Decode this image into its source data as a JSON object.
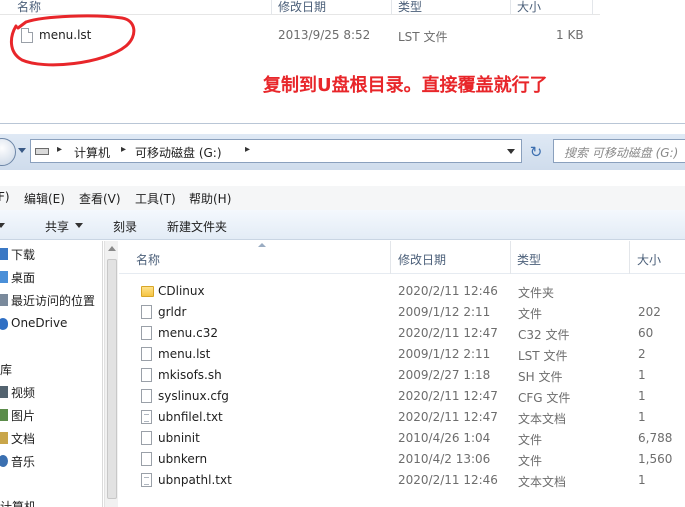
{
  "top": {
    "headers": {
      "name": "名称",
      "date": "修改日期",
      "type": "类型",
      "size": "大小"
    },
    "file": {
      "name": "menu.lst",
      "date": "2013/9/25 8:52",
      "type": "LST 文件",
      "size": "1 KB"
    },
    "note": "复制到U盘根目录。直接覆盖就行了",
    "note_color": "#e8262a"
  },
  "address": {
    "crumbs": [
      "计算机",
      "可移动磁盘 (G:)"
    ],
    "search_placeholder": "搜索 可移动磁盘 (G:)"
  },
  "menu": [
    "F)",
    "编辑(E)",
    "查看(V)",
    "工具(T)",
    "帮助(H)"
  ],
  "toolbar": {
    "share": "共享",
    "burn": "刻录",
    "new_folder": "新建文件夹"
  },
  "nav": {
    "favorites": [
      "下载",
      "桌面",
      "最近访问的位置"
    ],
    "onedrive": "OneDrive",
    "libraries_header": "库",
    "libraries": [
      "视频",
      "图片",
      "文档",
      "音乐"
    ],
    "computer": "计算机"
  },
  "columns": {
    "name": "名称",
    "date": "修改日期",
    "type": "类型",
    "size": "大小"
  },
  "files": [
    {
      "name": "CDlinux",
      "date": "2020/2/11 12:46",
      "type": "文件夹",
      "size": "",
      "icon": "folder"
    },
    {
      "name": "grldr",
      "date": "2009/1/12 2:11",
      "type": "文件",
      "size": "202",
      "icon": "file"
    },
    {
      "name": "menu.c32",
      "date": "2020/2/11 12:47",
      "type": "C32 文件",
      "size": "60",
      "icon": "file"
    },
    {
      "name": "menu.lst",
      "date": "2009/1/12 2:11",
      "type": "LST 文件",
      "size": "2",
      "icon": "file"
    },
    {
      "name": "mkisofs.sh",
      "date": "2009/2/27 1:18",
      "type": "SH 文件",
      "size": "1",
      "icon": "file"
    },
    {
      "name": "syslinux.cfg",
      "date": "2020/2/11 12:47",
      "type": "CFG 文件",
      "size": "1",
      "icon": "file"
    },
    {
      "name": "ubnfilel.txt",
      "date": "2020/2/11 12:47",
      "type": "文本文档",
      "size": "1",
      "icon": "txt"
    },
    {
      "name": "ubninit",
      "date": "2010/4/26 1:04",
      "type": "文件",
      "size": "6,788",
      "icon": "file"
    },
    {
      "name": "ubnkern",
      "date": "2010/4/2 13:06",
      "type": "文件",
      "size": "1,560",
      "icon": "file"
    },
    {
      "name": "ubnpathl.txt",
      "date": "2020/2/11 12:46",
      "type": "文本文档",
      "size": "1",
      "icon": "txt"
    }
  ]
}
